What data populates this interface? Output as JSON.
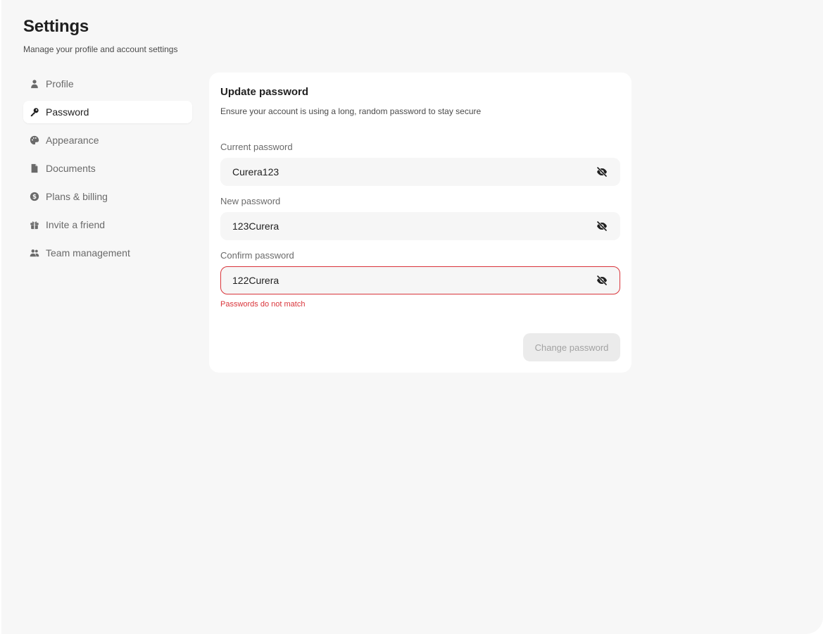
{
  "header": {
    "title": "Settings",
    "subtitle": "Manage your profile and account settings"
  },
  "sidebar": {
    "items": [
      {
        "label": "Profile",
        "icon": "user-icon",
        "active": false
      },
      {
        "label": "Password",
        "icon": "key-icon",
        "active": true
      },
      {
        "label": "Appearance",
        "icon": "palette-icon",
        "active": false
      },
      {
        "label": "Documents",
        "icon": "document-icon",
        "active": false
      },
      {
        "label": "Plans & billing",
        "icon": "dollar-icon",
        "active": false
      },
      {
        "label": "Invite a friend",
        "icon": "gift-icon",
        "active": false
      },
      {
        "label": "Team management",
        "icon": "users-icon",
        "active": false
      }
    ]
  },
  "card": {
    "title": "Update password",
    "description": "Ensure your account is using a long, random password to stay secure",
    "fields": {
      "current": {
        "label": "Current password",
        "value": "Curera123"
      },
      "new": {
        "label": "New password",
        "value": "123Curera"
      },
      "confirm": {
        "label": "Confirm password",
        "value": "122Curera"
      }
    },
    "error_message": "Passwords do not match",
    "submit_label": "Change password"
  },
  "colors": {
    "background": "#f7f7f7",
    "card": "#ffffff",
    "error": "#d9343a",
    "disabled_button": "#ebebeb"
  }
}
